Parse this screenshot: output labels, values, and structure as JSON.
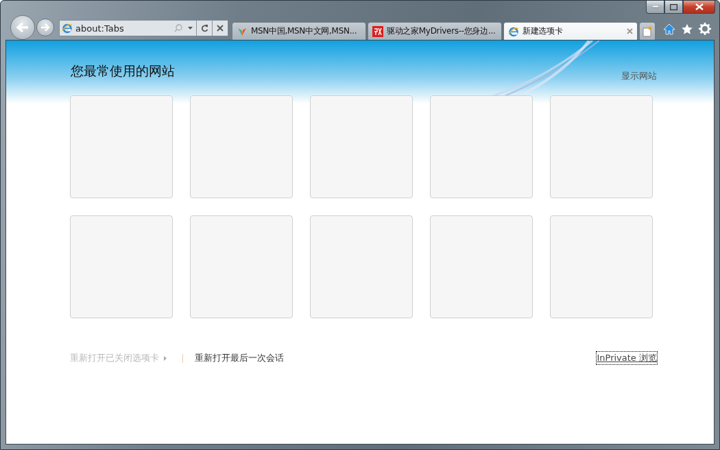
{
  "address_bar": {
    "value": "about:Tabs"
  },
  "tabs": [
    {
      "label": "MSN中国,MSN中文网,MSN...",
      "kind": "msn",
      "selected": false
    },
    {
      "label": "驱动之家MyDrivers--您身边...",
      "kind": "mydrivers",
      "selected": false
    },
    {
      "label": "新建选项卡",
      "kind": "ie",
      "selected": true
    }
  ],
  "page": {
    "title": "您最常使用的网站",
    "show_sites": "显示网站",
    "tiles": [
      {
        "kind": "empty"
      },
      {
        "kind": "empty"
      },
      {
        "kind": "empty"
      },
      {
        "kind": "empty"
      },
      {
        "kind": "empty"
      },
      {
        "kind": "empty"
      },
      {
        "kind": "empty"
      },
      {
        "kind": "empty"
      },
      {
        "kind": "empty"
      },
      {
        "kind": "empty"
      }
    ]
  },
  "footer_links": [
    {
      "label": "重新打开已关闭选项卡",
      "kind": "menu",
      "disabled": true
    },
    {
      "label": "重新打开最后一次会话",
      "kind": "link",
      "disabled": false
    }
  ],
  "inprivate": {
    "label": "InPrivate 浏览",
    "focused": true
  }
}
